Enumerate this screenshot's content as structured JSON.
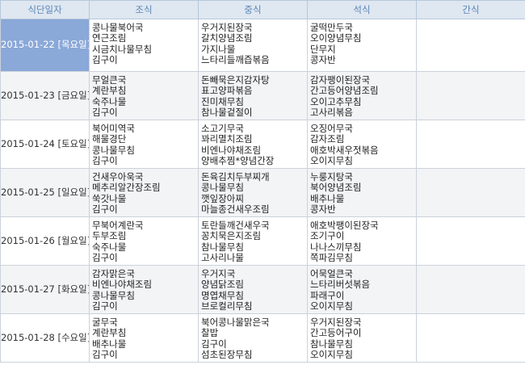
{
  "headers": [
    "식단일자",
    "조식",
    "중식",
    "석식",
    "간식"
  ],
  "rows": [
    {
      "date": "2015-01-22 [목요일]",
      "selected": true,
      "breakfast": [
        "콩나물북어국",
        "연근조림",
        "시금치나물무침",
        "김구이"
      ],
      "lunch": [
        "우거지된장국",
        "갈치양념조림",
        "가지나물",
        "느타리들깨즙볶음"
      ],
      "dinner": [
        "굴떡만두국",
        "오이양념무침",
        "단무지",
        "콩자반"
      ],
      "snack": []
    },
    {
      "date": "2015-01-23 [금요일]",
      "selected": false,
      "breakfast": [
        "무얼큰국",
        "계란부침",
        "숙주나물",
        "김구이"
      ],
      "lunch": [
        "돈빼묵은지감자탕",
        "표고양파볶음",
        "진미채무침",
        "참나물겉절이"
      ],
      "dinner": [
        "감자팽이된장국",
        "간고등어양념조림",
        "오이고추무침",
        "고사리볶음"
      ],
      "snack": []
    },
    {
      "date": "2015-01-24 [토요일]",
      "selected": false,
      "breakfast": [
        "북어미역국",
        "해물경단",
        "콩나물무침",
        "김구이"
      ],
      "lunch": [
        "소고기무국",
        "꽈리멸치조림",
        "비엔나야채조림",
        "양배추찜*양념간장"
      ],
      "dinner": [
        "오징어무국",
        "감자조림",
        "애호박새우젓볶음",
        "오이지무침"
      ],
      "snack": []
    },
    {
      "date": "2015-01-25 [일요일]",
      "selected": false,
      "breakfast": [
        "건새우아욱국",
        "메추리알간장조림",
        "쑥갓나물",
        "김구이"
      ],
      "lunch": [
        "돈육김치두부찌개",
        "콩나물무침",
        "깻잎장아찌",
        "마늘종건새우조림"
      ],
      "dinner": [
        "누룽지탕국",
        "북어양념조림",
        "배추나물",
        "콩자반"
      ],
      "snack": []
    },
    {
      "date": "2015-01-26 [월요일]",
      "selected": false,
      "breakfast": [
        "무북어계란국",
        "두부조림",
        "숙주나물",
        "김구이"
      ],
      "lunch": [
        "토란들깨건새우국",
        "꽁치묵은지조림",
        "참나물무침",
        "고사리나물"
      ],
      "dinner": [
        "애호박팽이된장국",
        "조기구이",
        "나나스끼무침",
        "쪽파김무침"
      ],
      "snack": []
    },
    {
      "date": "2015-01-27 [화요일]",
      "selected": false,
      "breakfast": [
        "감자맑은국",
        "비엔나야채조림",
        "콩나물무침",
        "김구이"
      ],
      "lunch": [
        "우거지국",
        "양념닭조림",
        "명엽채무침",
        "브로컬리무침"
      ],
      "dinner": [
        "어묵얼큰국",
        "느타리버섯볶음",
        "파래구이",
        "오이지무침"
      ],
      "snack": []
    },
    {
      "date": "2015-01-28 [수요일]",
      "selected": false,
      "breakfast": [
        "굴무국",
        "계란부침",
        "배추나물",
        "김구이"
      ],
      "lunch": [
        "북어콩나물맑은국",
        "찰밥",
        "김구이",
        "섬초된장무침"
      ],
      "dinner": [
        "우거지된장국",
        "간고등어구이",
        "참나물무침",
        "오이지무침"
      ],
      "snack": []
    }
  ]
}
